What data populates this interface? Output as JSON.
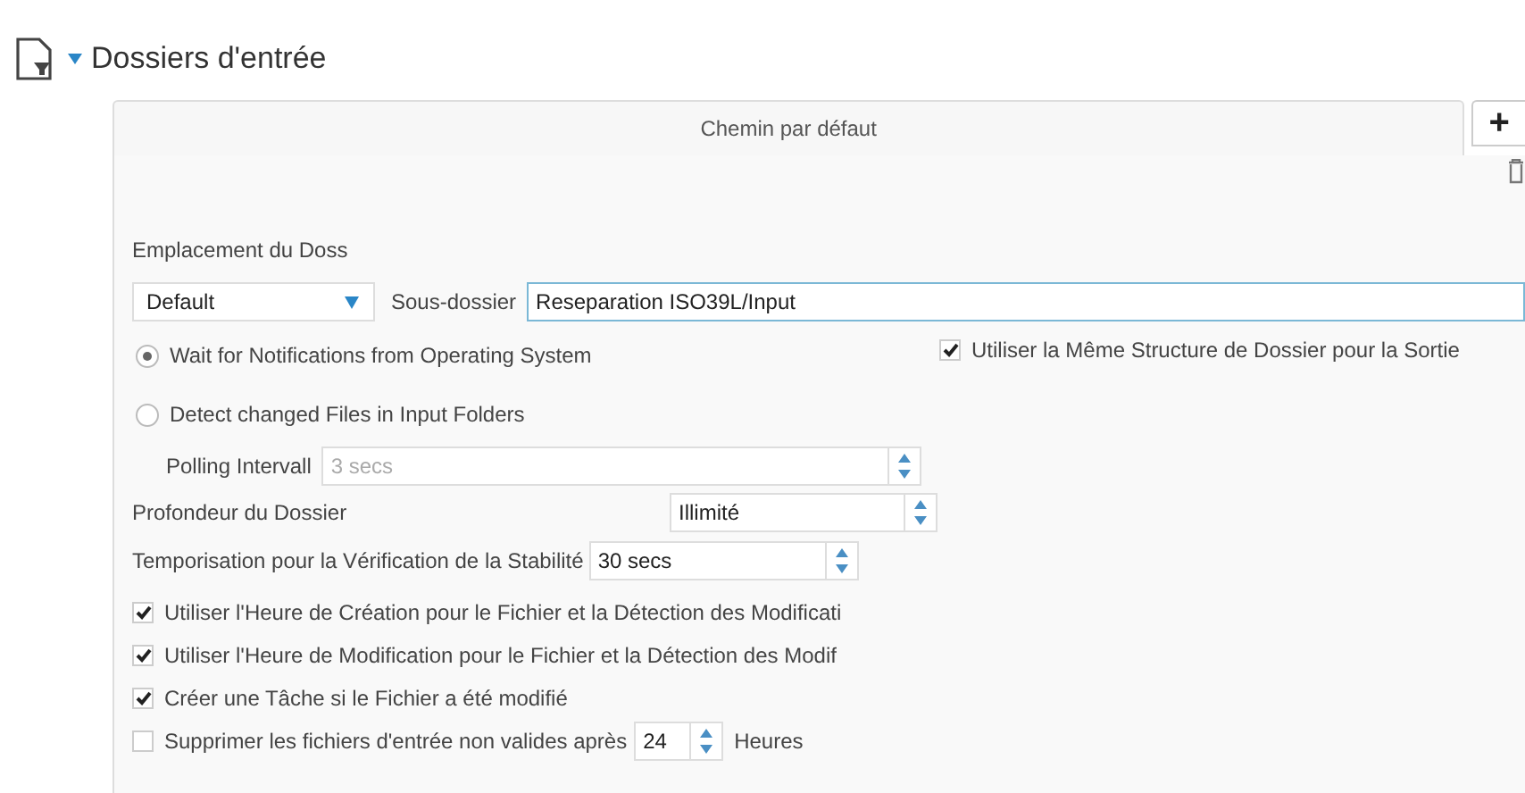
{
  "header": {
    "title": "Dossiers d'entrée",
    "expanded": true
  },
  "tabs": [
    {
      "label": "Chemin par défaut",
      "selected": true
    }
  ],
  "add_button": "+",
  "location_label": "Emplacement du Doss",
  "folder_select": {
    "value": "Default"
  },
  "subfolder": {
    "label": "Sous-dossier",
    "value": "Reseparation ISO39L/Input"
  },
  "mode_options": [
    {
      "label": "Wait for Notifications from Operating System",
      "selected": true
    },
    {
      "label": "Detect changed Files in Input Folders",
      "selected": false
    }
  ],
  "same_structure": {
    "label": "Utiliser la Même Structure de Dossier pour la Sortie",
    "checked": true
  },
  "polling": {
    "label": "Polling Intervall",
    "value": "3 secs",
    "disabled": true
  },
  "depth": {
    "label": "Profondeur du Dossier",
    "value": "Illimité"
  },
  "stability": {
    "label": "Temporisation pour la Vérification de la Stabilité",
    "value": "30 secs"
  },
  "options": [
    {
      "label": "Utiliser l'Heure de Création pour le Fichier et la Détection des Modificati",
      "checked": true
    },
    {
      "label": "Utiliser l'Heure de Modification pour le Fichier et la Détection des Modif",
      "checked": true
    },
    {
      "label": "Créer une Tâche si le Fichier a été modifié",
      "checked": true
    }
  ],
  "delete_invalid": {
    "label": "Supprimer les fichiers d'entrée non valides après",
    "checked": false,
    "value": "24",
    "unit": "Heures"
  }
}
